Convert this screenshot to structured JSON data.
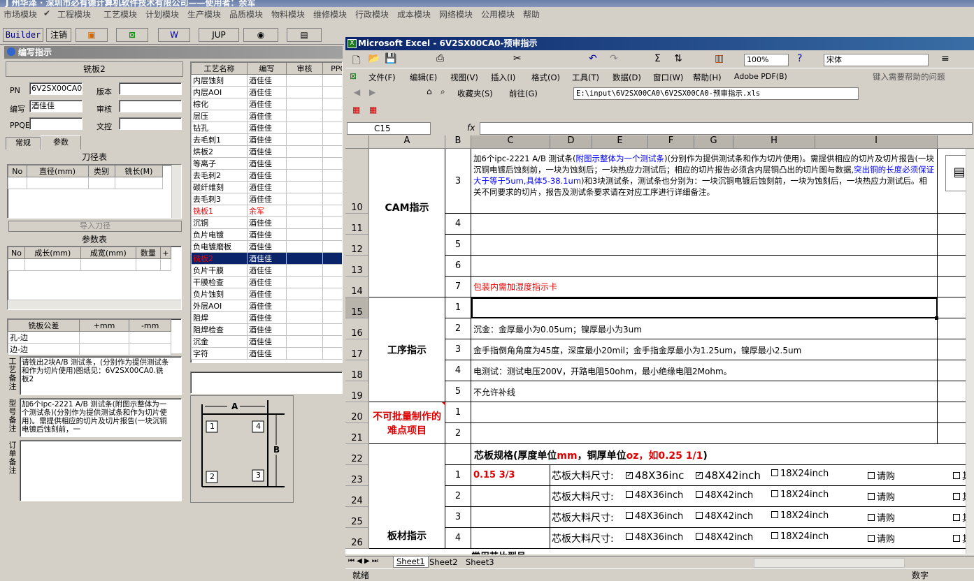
{
  "app": {
    "title": "J 州华泽 · 深圳市必有德计算机软件技术有限公司——使用者：余军",
    "menu": [
      "市场模块",
      "工程模块",
      "工艺模块",
      "计划模块",
      "生产模块",
      "品质模块",
      "物料模块",
      "维修模块",
      "行政模块",
      "成本模块",
      "网络模块",
      "公用模块",
      "帮助"
    ],
    "toolbar": [
      "Builder",
      "注销",
      "",
      "",
      "",
      "JUP",
      "",
      ""
    ]
  },
  "panel": {
    "title": "编写指示",
    "header": "铣板2",
    "fields": {
      "pn_label": "PN",
      "pn_value": "6V2SX00CA0",
      "version_label": "版本",
      "version_value": "",
      "writer_label": "编写",
      "writer_value": "酒佳佳",
      "review_label": "审核",
      "review_value": "",
      "ppqe_label": "PPQE",
      "ppqe_value": "",
      "control_label": "文控",
      "control_value": ""
    },
    "tabs": [
      "常规",
      "参数"
    ],
    "tool_table": {
      "title": "刀径表",
      "headers": [
        "No",
        "直径(mm)",
        "类别",
        "铣长(M)"
      ]
    },
    "import_button": "导入刀径",
    "param_table": {
      "title": "参数表",
      "headers": [
        "No",
        "成长(mm)",
        "成宽(mm)",
        "数量",
        "+"
      ]
    },
    "tol_table": {
      "headers": [
        "铣板公差",
        "+mm",
        "-mm"
      ],
      "rows": [
        "孔-边",
        "边-边"
      ]
    },
    "notes": [
      {
        "label": "工艺备注",
        "text": "请铣出2块A/B 测试条，(分别作为提供测试条和作为切片使用)图纸见：6V2SX00CA0.铣板2"
      },
      {
        "label": "型号备注",
        "text": "加6个ipc-2221 A/B 测试条(附图示整体为一个测试条)(分别作为提供测试条和作为切片使用)。需提供相应的切片及切片报告(一块沉铜电镀后蚀刻前，一"
      },
      {
        "label": "订单备注",
        "text": ""
      }
    ],
    "diagram": {
      "a": "A",
      "b": "B",
      "n1": "1",
      "n2": "2",
      "n3": "3",
      "n4": "4"
    }
  },
  "process_list": {
    "headers": [
      "工艺名称",
      "编写",
      "审核",
      "PPQE"
    ],
    "rows": [
      [
        "内层蚀刻",
        "酒佳佳"
      ],
      [
        "内层AOI",
        "酒佳佳"
      ],
      [
        "棕化",
        "酒佳佳"
      ],
      [
        "层压",
        "酒佳佳"
      ],
      [
        "钻孔",
        "酒佳佳"
      ],
      [
        "去毛刺1",
        "酒佳佳"
      ],
      [
        "烘板2",
        "酒佳佳"
      ],
      [
        "等离子",
        "酒佳佳"
      ],
      [
        "去毛刺2",
        "酒佳佳"
      ],
      [
        "碳纤维刻",
        "酒佳佳"
      ],
      [
        "去毛刺3",
        "酒佳佳"
      ],
      [
        "铣板1",
        "余军"
      ],
      [
        "沉铜",
        "酒佳佳"
      ],
      [
        "负片电镀",
        "酒佳佳"
      ],
      [
        "负电镀磨板",
        "酒佳佳"
      ],
      [
        "铣板2",
        "酒佳佳"
      ],
      [
        "负片干膜",
        "酒佳佳"
      ],
      [
        "干膜检查",
        "酒佳佳"
      ],
      [
        "负片蚀刻",
        "酒佳佳"
      ],
      [
        "外层AOI",
        "酒佳佳"
      ],
      [
        "阻焊",
        "酒佳佳"
      ],
      [
        "阻焊检查",
        "酒佳佳"
      ],
      [
        "沉金",
        "酒佳佳"
      ],
      [
        "字符",
        "酒佳佳"
      ]
    ]
  },
  "excel": {
    "title": "Microsoft Excel - 6V2SX00CA0-预审指示",
    "zoom": "100%",
    "font": "宋体",
    "help_placeholder": "键入需要帮助的问题",
    "menu": [
      "文件(F)",
      "编辑(E)",
      "视图(V)",
      "插入(I)",
      "格式(O)",
      "工具(T)",
      "数据(D)",
      "窗口(W)",
      "帮助(H)",
      "Adobe PDF(B)"
    ],
    "web": {
      "favorites": "收藏夹(S)",
      "goto": "前往(G)",
      "path": "E:\\input\\6V2SX00CA0\\6V2SX00CA0-预审指示.xls"
    },
    "namebox": "C15",
    "fx": "fx",
    "columns": [
      "A",
      "B",
      "C",
      "D",
      "E",
      "F",
      "G",
      "H",
      "I"
    ],
    "rows": [
      "10",
      "11",
      "12",
      "13",
      "14",
      "15",
      "16",
      "17",
      "18",
      "19",
      "20",
      "21",
      "22",
      "23",
      "24",
      "25",
      "26"
    ],
    "sections": {
      "cam": "CAM指示",
      "process": "工序指示",
      "hard": "不可批量制作的难点项目",
      "board": "板材指示"
    },
    "cam_text": {
      "p1": "加6个ipc-2221 A/B 测试条(",
      "p2": "附图示整体为一个测试条",
      "p3": ")(分别作为提供测试条和作为切片使用)。需提供相应的切片及切片报告(一块沉铜电镀后蚀刻前，一块为蚀刻后；一块热应力测试后；相应的切片报告必须含内层铜凸出的切片图与数据,",
      "p4": "突出铜的长度必须保证大于等于5um,具体5-38.1um",
      "p5": ")和3块测试条，测试条也分别为：一块沉铜电镀后蚀刻前，一块为蚀刻后，一块热应力测试后。相关不同要求的切片，报告及测试条要求请在对应工序进行详细备注。"
    },
    "cam_nums": [
      "3",
      "4",
      "5",
      "6",
      "7"
    ],
    "row14_text": "包装内需加湿度指示卡",
    "proc_nums": [
      "1",
      "2",
      "3",
      "4",
      "5"
    ],
    "proc_text": [
      "",
      "沉金：金厚最小为0.05um；镍厚最小为3um",
      "金手指倒角角度为45度，深度最小20mil；金手指金厚最小为1.25um，镍厚最小2.5um",
      "电测试：测试电压200V，开路电阻50ohm，最小绝缘电阻2Mohm。",
      "不允许补线"
    ],
    "hard_nums": [
      "1",
      "2"
    ],
    "core": {
      "t1": "芯板规格(厚度单位",
      "t2": "mm",
      "t3": "，铜厚单位",
      "t4": "oz",
      "t5": "，如0.25 1/1",
      "t6": ")",
      "nums": [
        "1",
        "2",
        "3",
        "4"
      ],
      "spec": "0.15 3/3",
      "label": "芯板大料尺寸:",
      "o1": "48X36inch",
      "o1b": "48X36inc",
      "o2": "48X42inch",
      "o3": "18X24inch",
      "o4": "请购",
      "o5": "其",
      "check": "✓"
    },
    "row27_partial": "常用芯片型号",
    "sheets": [
      "Sheet1",
      "Sheet2",
      "Sheet3"
    ],
    "status": "就绪",
    "status_right": "数字"
  }
}
